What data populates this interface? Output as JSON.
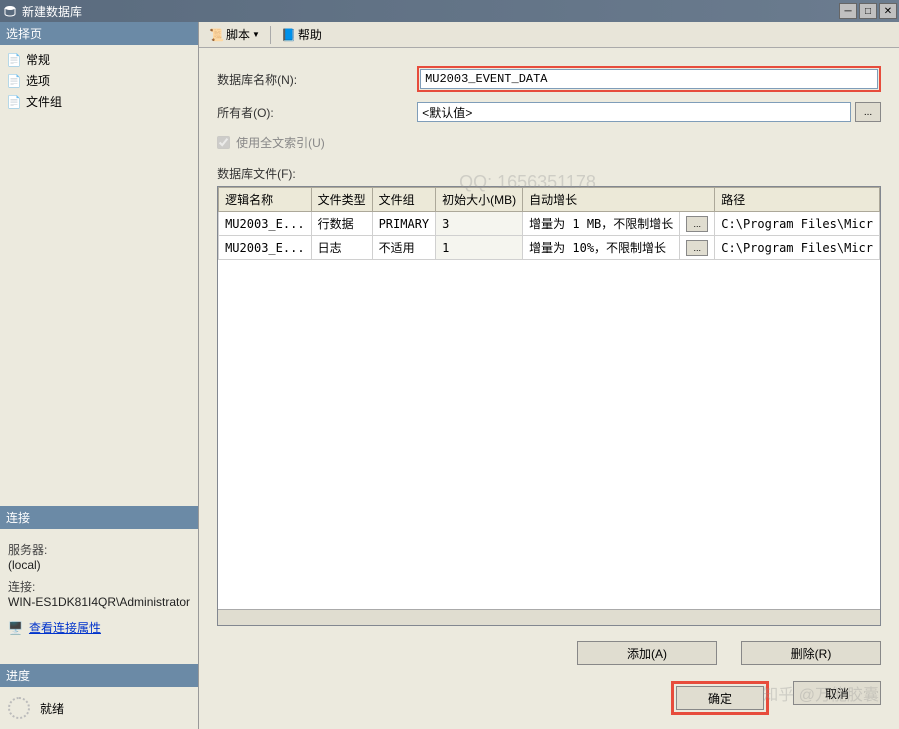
{
  "titlebar": {
    "title": "新建数据库"
  },
  "sidebar": {
    "select_page_header": "选择页",
    "nav": [
      {
        "label": "常规"
      },
      {
        "label": "选项"
      },
      {
        "label": "文件组"
      }
    ],
    "connection_header": "连接",
    "server_label": "服务器:",
    "server_value": "(local)",
    "conn_label": "连接:",
    "conn_value": "WIN-ES1DK81I4QR\\Administrator",
    "view_props_link": "查看连接属性",
    "progress_header": "进度",
    "progress_status": "就绪"
  },
  "toolbar": {
    "script_label": "脚本",
    "help_label": "帮助"
  },
  "form": {
    "db_name_label": "数据库名称(N):",
    "db_name_value": "MU2003_EVENT_DATA",
    "owner_label": "所有者(O):",
    "owner_value": "<默认值>",
    "fulltext_label": "使用全文索引(U)",
    "files_label": "数据库文件(F):"
  },
  "grid": {
    "headers": [
      "逻辑名称",
      "文件类型",
      "文件组",
      "初始大小(MB)",
      "自动增长",
      "",
      "路径"
    ],
    "rows": [
      {
        "name": "MU2003_E...",
        "type": "行数据",
        "group": "PRIMARY",
        "size": "3",
        "growth": "增量为 1 MB，不限制增长",
        "path": "C:\\Program Files\\Micr"
      },
      {
        "name": "MU2003_E...",
        "type": "日志",
        "group": "不适用",
        "size": "1",
        "growth": "增量为 10%，不限制增长",
        "path": "C:\\Program Files\\Micr"
      }
    ]
  },
  "buttons": {
    "add": "添加(A)",
    "remove": "删除(R)",
    "ok": "确定",
    "cancel": "取消"
  },
  "watermark": {
    "w1": "QQ: 1656351178",
    "w2": "知乎 @万能胶囊"
  }
}
